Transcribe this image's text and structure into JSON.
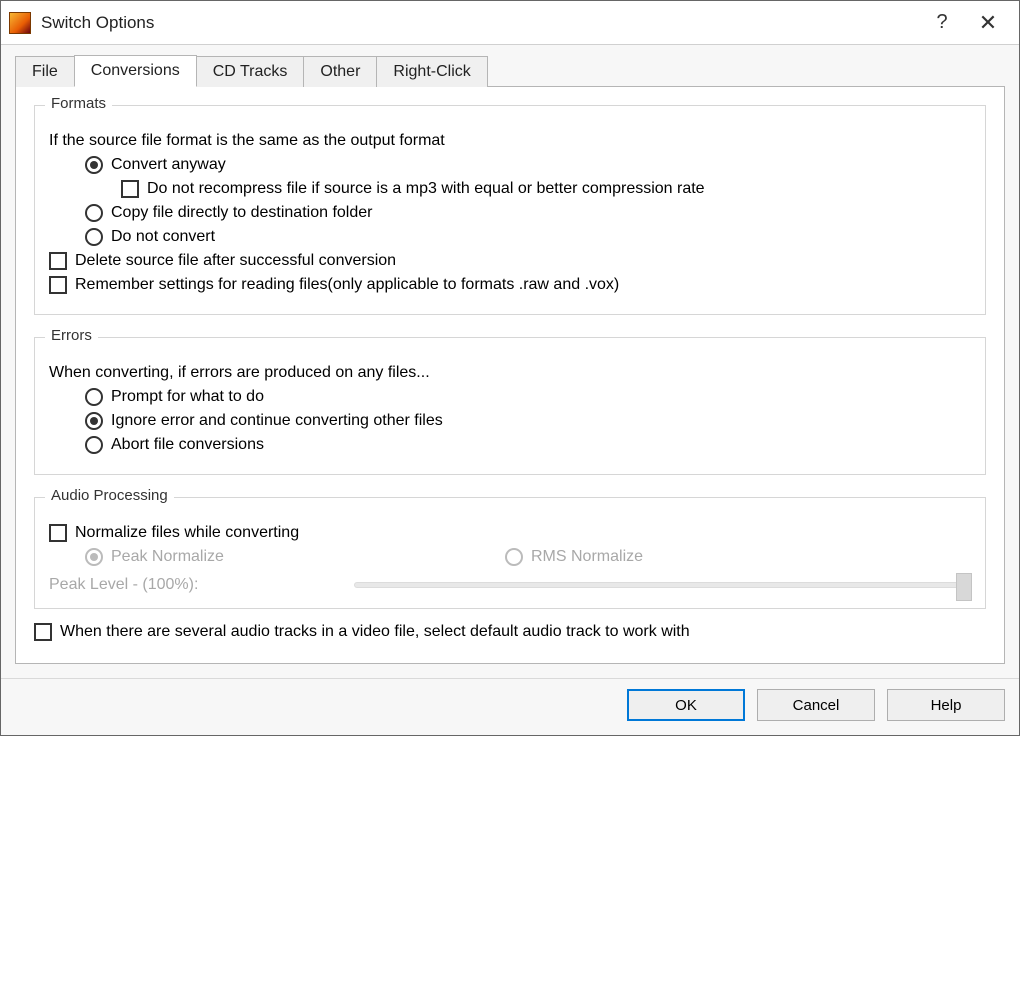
{
  "window": {
    "title": "Switch Options"
  },
  "tabs": {
    "file": "File",
    "conversions": "Conversions",
    "cdtracks": "CD Tracks",
    "other": "Other",
    "rightclick": "Right-Click"
  },
  "formats": {
    "group": "Formats",
    "intro": "If the source file format is the same as the output format",
    "convert_anyway": "Convert anyway",
    "no_recompress": "Do not recompress file if source is a mp3 with equal or better compression rate",
    "copy_direct": "Copy file directly to destination folder",
    "do_not_convert": "Do not convert",
    "delete_source": "Delete source file after successful conversion",
    "remember_settings": "Remember settings for reading files(only applicable to formats .raw and .vox)"
  },
  "errors": {
    "group": "Errors",
    "intro": "When converting, if errors are produced on any files...",
    "prompt": "Prompt for what to do",
    "ignore": "Ignore error and continue converting other files",
    "abort": "Abort file conversions"
  },
  "audio": {
    "group": "Audio Processing",
    "normalize": "Normalize files while converting",
    "peak": "Peak Normalize",
    "rms": "RMS Normalize",
    "peak_level": "Peak Level - (100%):"
  },
  "bottom": {
    "multi_tracks": "When there are several audio tracks in a video file, select default audio track to work with"
  },
  "buttons": {
    "ok": "OK",
    "cancel": "Cancel",
    "help": "Help"
  }
}
